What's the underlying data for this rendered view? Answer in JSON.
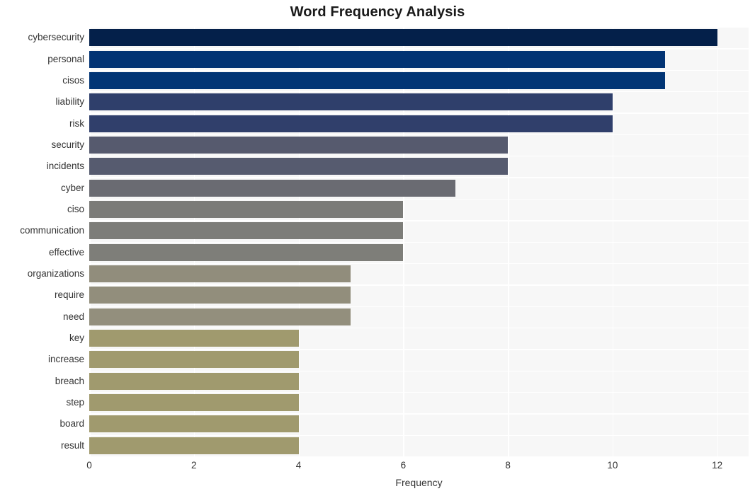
{
  "chart_data": {
    "type": "bar",
    "orientation": "horizontal",
    "title": "Word Frequency Analysis",
    "xlabel": "Frequency",
    "ylabel": "",
    "xlim": [
      0,
      12.6
    ],
    "ylim": [
      0,
      20
    ],
    "xticks": [
      0,
      2,
      4,
      6,
      8,
      10,
      12
    ],
    "xticklabels": [
      "0",
      "2",
      "4",
      "6",
      "8",
      "10",
      "12"
    ],
    "grid": "both-white-on-light-gray",
    "legend": "none",
    "categories": [
      "cybersecurity",
      "personal",
      "cisos",
      "liability",
      "risk",
      "security",
      "incidents",
      "cyber",
      "ciso",
      "communication",
      "effective",
      "organizations",
      "require",
      "need",
      "key",
      "increase",
      "breach",
      "step",
      "board",
      "result"
    ],
    "values": [
      12,
      11,
      11,
      10,
      10,
      8,
      8,
      7,
      6,
      6,
      6,
      5,
      5,
      5,
      4,
      4,
      4,
      4,
      4,
      4
    ],
    "bar_colors": [
      "#04204a",
      "#023373",
      "#023575",
      "#2f3f6b",
      "#303f6b",
      "#565a6e",
      "#565b6f",
      "#6a6b72",
      "#7b7b78",
      "#7d7d79",
      "#7e7e79",
      "#918d7c",
      "#928e7c",
      "#938f7d",
      "#a09a6e",
      "#a09a6e",
      "#a09a6e",
      "#a09a6e",
      "#a09a6e",
      "#a09a6e"
    ]
  },
  "colors": {
    "plot_background": "#f7f7f7",
    "figure_background": "#ffffff",
    "gridline": "#ffffff",
    "title_text": "#1a1a1a",
    "tick_text": "#333333"
  }
}
